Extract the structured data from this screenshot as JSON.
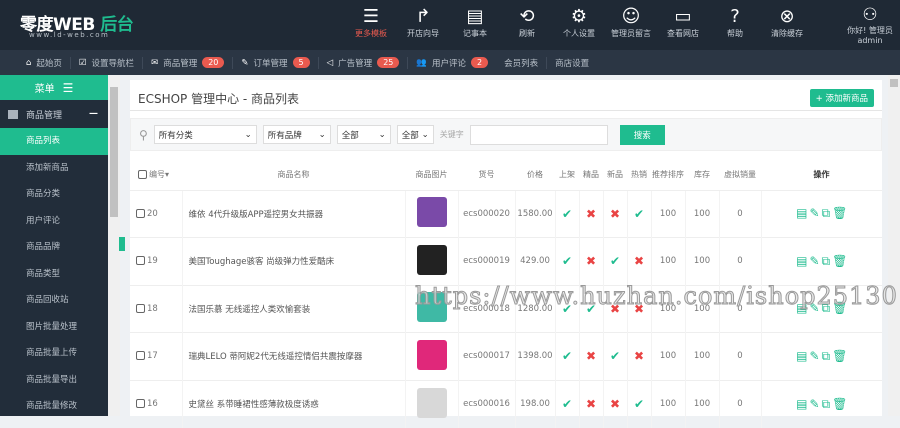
{
  "header": {
    "logo_main": "零度WEB",
    "logo_accent": "后台",
    "logo_sub": "www.ld-web.com",
    "tools": [
      {
        "label": "更多模板",
        "icon": "menu-icon"
      },
      {
        "label": "开店向导",
        "icon": "share-arrow-icon"
      },
      {
        "label": "记事本",
        "icon": "notepad-icon"
      },
      {
        "label": "刷新",
        "icon": "refresh-icon"
      },
      {
        "label": "个人设置",
        "icon": "gear-icon"
      },
      {
        "label": "管理员留言",
        "icon": "message-icon"
      },
      {
        "label": "查看网店",
        "icon": "monitor-icon"
      },
      {
        "label": "帮助",
        "icon": "help-icon"
      },
      {
        "label": "清除缓存",
        "icon": "clear-icon"
      }
    ],
    "user_greeting": "你好! 管理员",
    "user_name": "admin"
  },
  "nav": {
    "items": [
      {
        "label": "起始页"
      },
      {
        "label": "设置导航栏"
      },
      {
        "label": "商品管理",
        "badge": "20"
      },
      {
        "label": "订单管理",
        "badge": "5"
      },
      {
        "label": "广告管理",
        "badge": "25"
      },
      {
        "label": "用户评论",
        "badge": "2"
      },
      {
        "label": "会员列表"
      },
      {
        "label": "商店设置"
      }
    ]
  },
  "sidebar": {
    "title": "菜单",
    "group": "商品管理",
    "items": [
      "商品列表",
      "添加新商品",
      "商品分类",
      "用户评论",
      "商品品牌",
      "商品类型",
      "商品回收站",
      "图片批量处理",
      "商品批量上传",
      "商品批量导出",
      "商品批量修改"
    ]
  },
  "main": {
    "title": "ECSHOP 管理中心 - 商品列表",
    "add_button": "+ 添加新商品",
    "filter": {
      "category": "所有分类",
      "brand": "所有品牌",
      "select3": "全部",
      "select4": "全部",
      "keyword_label": "关键字",
      "keyword_value": "",
      "search_button": "搜索"
    },
    "columns": [
      "编号",
      "商品名称",
      "商品图片",
      "货号",
      "价格",
      "上架",
      "精品",
      "新品",
      "热销",
      "推荐排序",
      "库存",
      "虚拟销量",
      "操作"
    ],
    "rows": [
      {
        "id": "20",
        "name": "维依 4代升级版APP遥控男女共振器",
        "image_color": "#7a4aa8",
        "sn": "ecs000020",
        "price": "1580.00",
        "on_sale": true,
        "best": false,
        "new": false,
        "hot": true,
        "sort": "100",
        "stock": "100",
        "virtual_sales": "0"
      },
      {
        "id": "19",
        "name": "美国Toughage骇客 尚级弹力性爱酷床",
        "image_color": "#222222",
        "sn": "ecs000019",
        "price": "429.00",
        "on_sale": true,
        "best": false,
        "new": true,
        "hot": false,
        "sort": "100",
        "stock": "100",
        "virtual_sales": "0"
      },
      {
        "id": "18",
        "name": "法国乐慕 无线遥控人类欢愉套装",
        "image_color": "#3fb9a5",
        "sn": "ecs000018",
        "price": "1280.00",
        "on_sale": true,
        "best": true,
        "new": false,
        "hot": false,
        "sort": "100",
        "stock": "100",
        "virtual_sales": "0"
      },
      {
        "id": "17",
        "name": "瑞典LELO 蒂阿妮2代无线遥控情侣共震按摩器",
        "image_color": "#e0287a",
        "sn": "ecs000017",
        "price": "1398.00",
        "on_sale": true,
        "best": false,
        "new": true,
        "hot": false,
        "sort": "100",
        "stock": "100",
        "virtual_sales": "0"
      },
      {
        "id": "16",
        "name": "史黛丝 系带睡裙性感薄款极度诱惑",
        "image_color": "#d8d8d8",
        "sn": "ecs000016",
        "price": "198.00",
        "on_sale": true,
        "best": false,
        "new": false,
        "hot": true,
        "sort": "100",
        "stock": "100",
        "virtual_sales": "0"
      }
    ]
  },
  "watermark": "https://www.huzhan.com/ishop25130"
}
